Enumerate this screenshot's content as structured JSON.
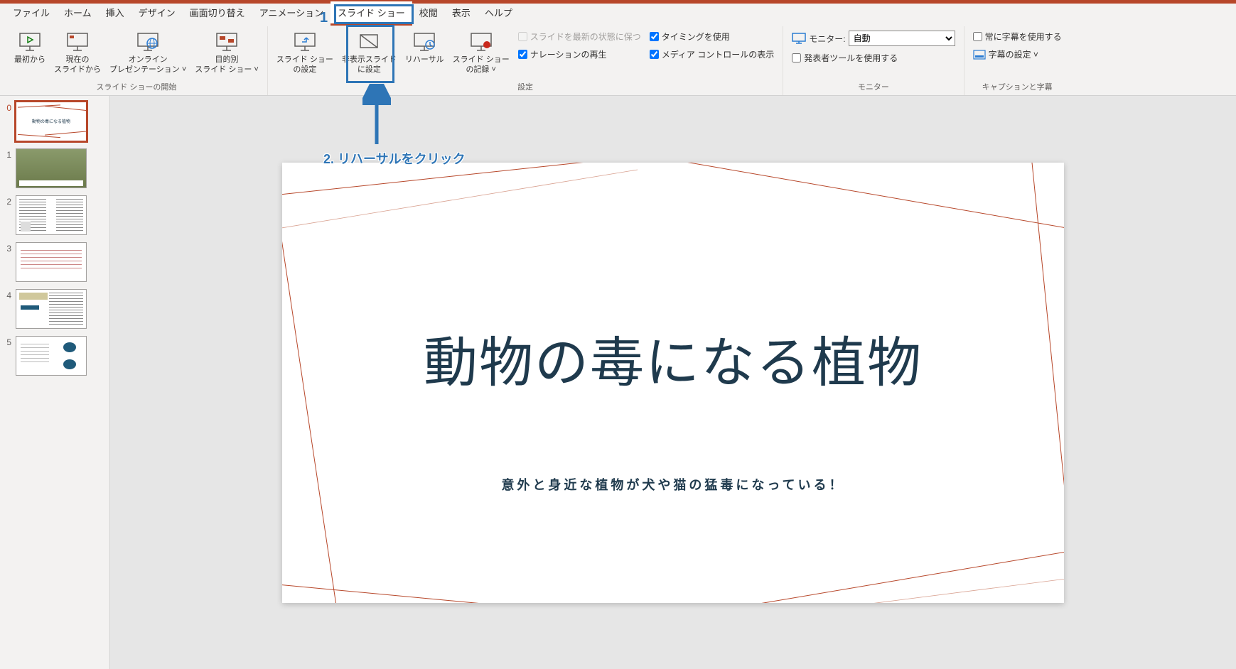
{
  "menubar": {
    "items": [
      "ファイル",
      "ホーム",
      "挿入",
      "デザイン",
      "画面切り替え",
      "アニメーション",
      "スライド ショー",
      "校閲",
      "表示",
      "ヘルプ"
    ],
    "active_index": 6
  },
  "ribbon": {
    "group1": {
      "label": "スライド ショーの開始",
      "btn_from_start": "最初から",
      "btn_from_current": "現在の\nスライドから",
      "btn_online": "オンライン\nプレゼンテーション ˅",
      "btn_custom": "目的別\nスライド ショー ˅"
    },
    "group2": {
      "label": "設定",
      "btn_setup": "スライド ショー\nの設定",
      "btn_hide": "非表示スライド\nに設定",
      "btn_rehearse": "リハーサル",
      "btn_record": "スライド ショー\nの記録 ˅",
      "chk_keep_latest": "スライドを最新の状態に保つ",
      "chk_timings": "タイミングを使用",
      "chk_narration": "ナレーションの再生",
      "chk_media": "メディア コントロールの表示"
    },
    "group3": {
      "label": "モニター",
      "monitor_label": "モニター:",
      "monitor_value": "自動",
      "chk_presenter": "発表者ツールを使用する"
    },
    "group4": {
      "label": "キャプションと字幕",
      "chk_subtitle": "常に字幕を使用する",
      "btn_subtitle_setting": "字幕の設定 ˅"
    }
  },
  "thumbnails": {
    "numbers": [
      "0",
      "1",
      "2",
      "3",
      "4",
      "5"
    ],
    "active_index": 0,
    "thumb0_text": "動物の毒になる植物"
  },
  "slide": {
    "title": "動物の毒になる植物",
    "subtitle": "意外と身近な植物が犬や猫の猛毒になっている！"
  },
  "annotation": {
    "num1": "1",
    "label2": "2. リハーサルをクリック"
  }
}
